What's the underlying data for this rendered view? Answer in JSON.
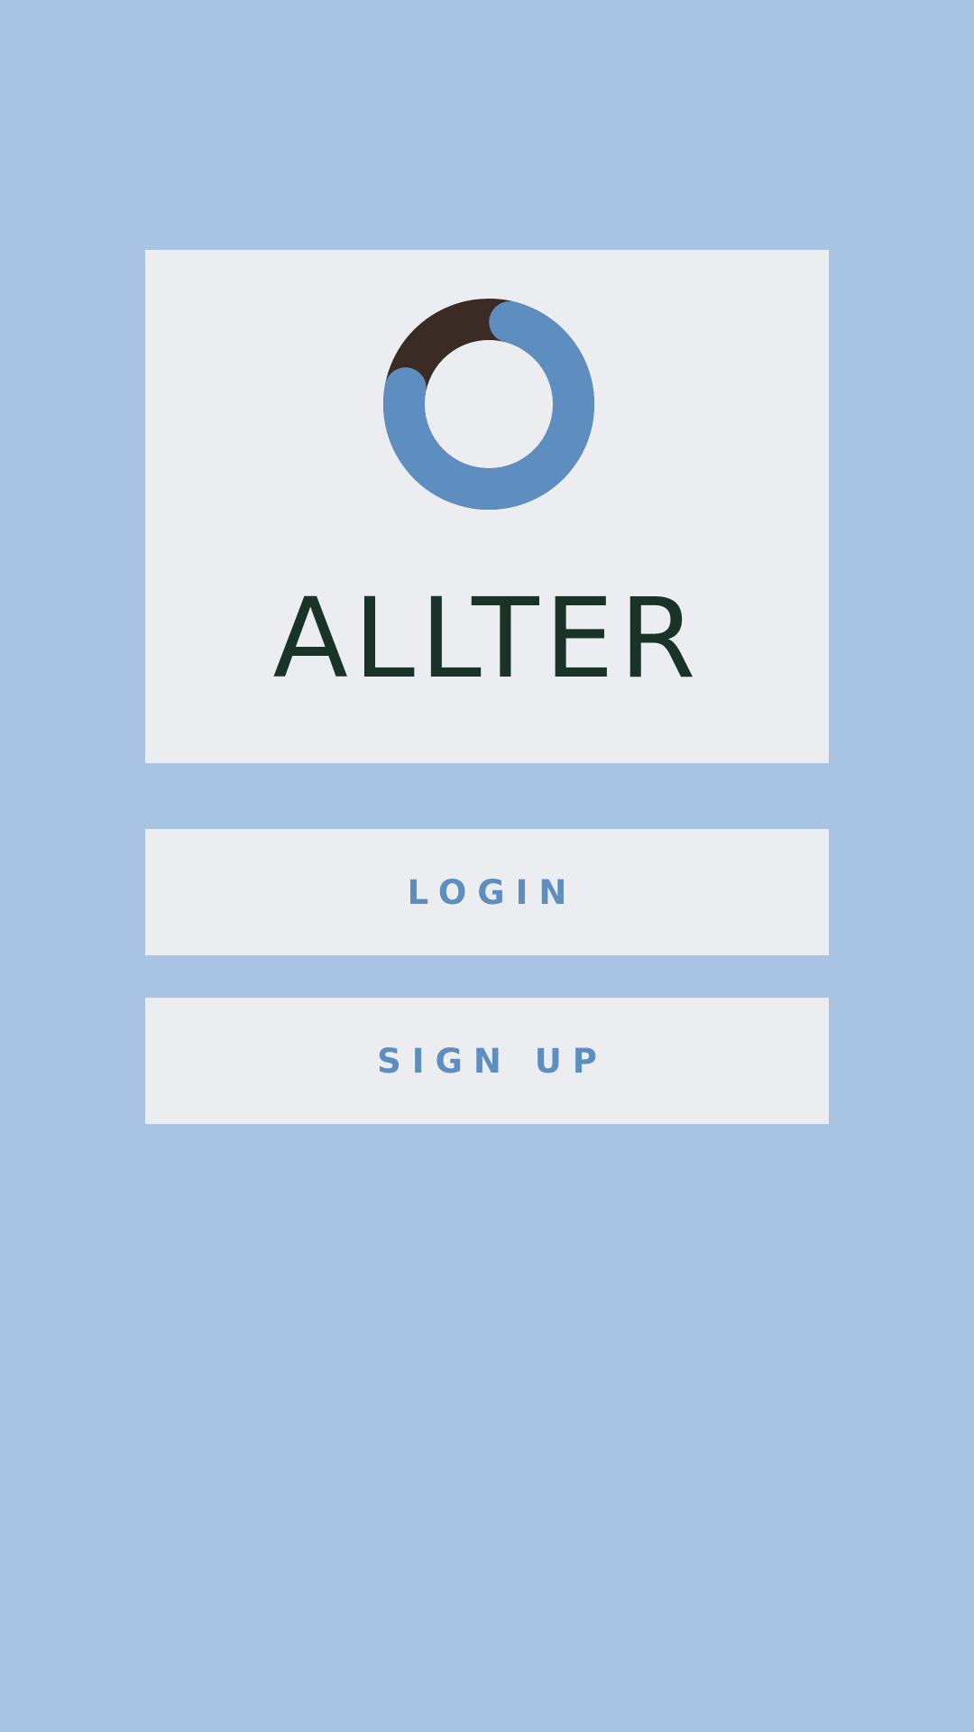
{
  "app": {
    "name": "ALLTER"
  },
  "logo": {
    "icon": "loading-ring-icon",
    "colors": {
      "ring_main": "#5e8ebf",
      "ring_segment": "#3a2b25"
    }
  },
  "buttons": {
    "login_label": "LOGIN",
    "signup_label": "SIGN UP"
  },
  "theme": {
    "background": "#a9c4e2",
    "card": "#ecedf0",
    "title_color": "#1a3329",
    "accent": "#5e8ebf"
  }
}
